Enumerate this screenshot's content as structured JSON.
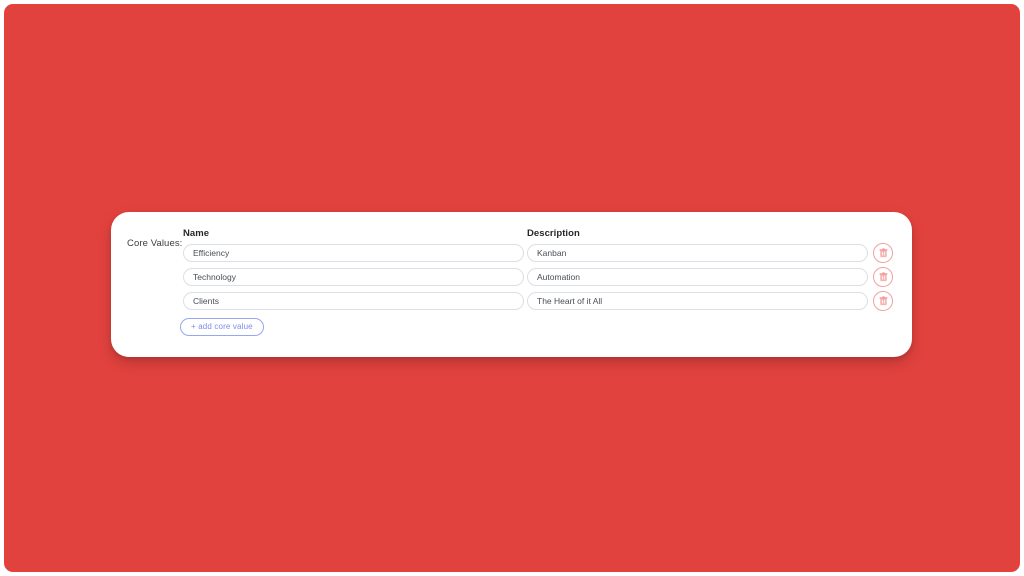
{
  "theme": {
    "backdrop_color": "#e2423e",
    "card_color": "#ffffff",
    "accent_blue": "#7b8ced",
    "delete_red": "#f2a19f",
    "field_border": "#dcdfe3",
    "text_color": "#4a4f55"
  },
  "core_values": {
    "section_label": "Core Values:",
    "columns": {
      "name": "Name",
      "description": "Description"
    },
    "rows": [
      {
        "name": "Efficiency",
        "description": "Kanban",
        "delete_icon": "trash-icon"
      },
      {
        "name": "Technology",
        "description": "Automation",
        "delete_icon": "trash-icon"
      },
      {
        "name": "Clients",
        "description": "The Heart of it All",
        "delete_icon": "trash-icon"
      }
    ],
    "add_button_label": "+ add core value"
  }
}
